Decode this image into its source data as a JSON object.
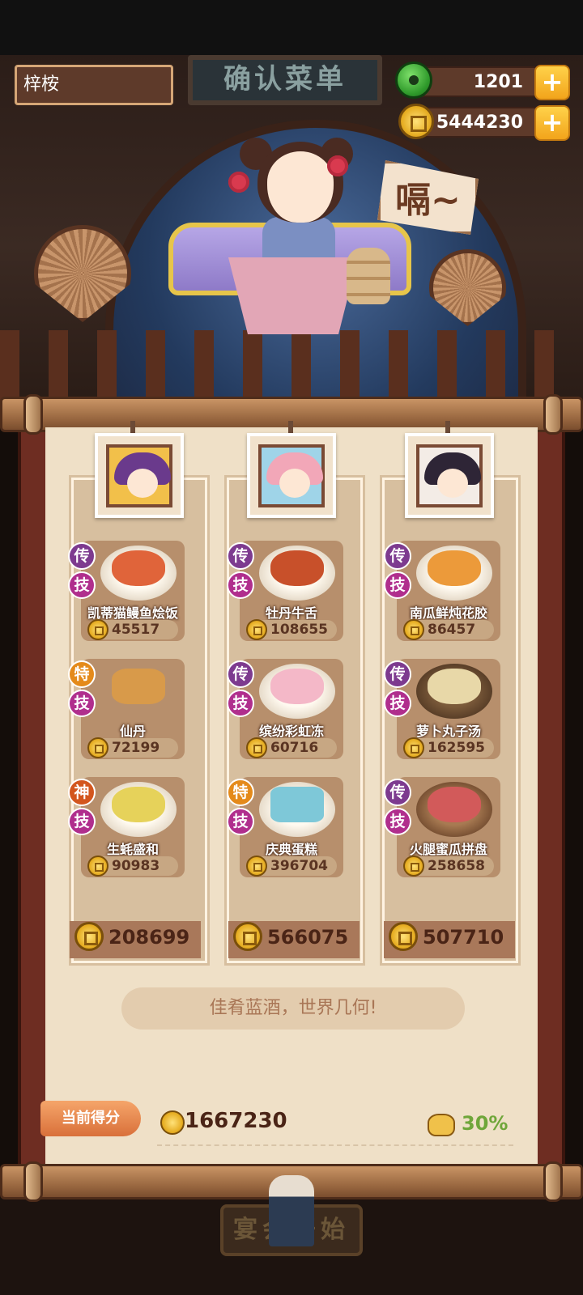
{
  "header": {
    "player_name": "梓桉",
    "title_sign": "确认菜单",
    "jade": "1201",
    "coins": "5444230",
    "plus": "+"
  },
  "chef_speech": "嗝~",
  "columns": [
    {
      "total": "208699",
      "dishes": [
        {
          "name": "凯蒂猫鳗鱼烩饭",
          "price": "45517",
          "rank": "传",
          "skill": "技"
        },
        {
          "name": "仙丹",
          "price": "72199",
          "rank": "特",
          "skill": "技"
        },
        {
          "name": "生蚝盛和",
          "price": "90983",
          "rank": "神",
          "skill": "技"
        }
      ]
    },
    {
      "total": "566075",
      "dishes": [
        {
          "name": "牡丹牛舌",
          "price": "108655",
          "rank": "传",
          "skill": "技"
        },
        {
          "name": "缤纷彩虹冻",
          "price": "60716",
          "rank": "传",
          "skill": "技"
        },
        {
          "name": "庆典蛋糕",
          "price": "396704",
          "rank": "特",
          "skill": "技"
        }
      ]
    },
    {
      "total": "507710",
      "dishes": [
        {
          "name": "南瓜鲜炖花胶",
          "price": "86457",
          "rank": "传",
          "skill": "技"
        },
        {
          "name": "萝卜丸子汤",
          "price": "162595",
          "rank": "传",
          "skill": "技"
        },
        {
          "name": "火腿蜜瓜拼盘",
          "price": "258658",
          "rank": "传",
          "skill": "技"
        }
      ]
    }
  ],
  "motto": "佳肴蓝酒，世界几何!",
  "score": {
    "label": "当前得分",
    "value": "1667230",
    "bonus": "30%"
  },
  "start_button": "宴会开始",
  "colors": {
    "legend_badge": "#7d3a8f",
    "skill_badge": "#b02e8d",
    "special_badge": "#e48a1a",
    "divine_badge": "#d3561e",
    "bonus_green": "#6fa63a"
  }
}
